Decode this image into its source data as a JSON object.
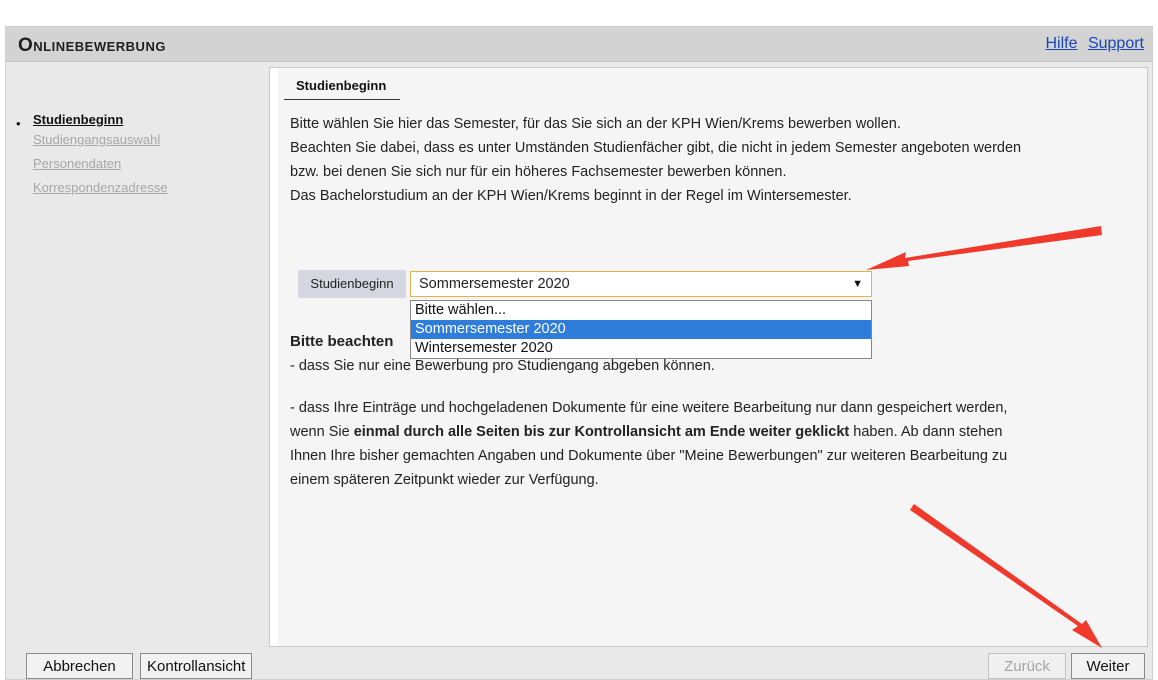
{
  "header": {
    "title": "Onlinebewerbung",
    "links": [
      "Hilfe",
      "Support"
    ]
  },
  "sidebar": {
    "items": [
      {
        "label": "Studienbeginn",
        "active": true
      },
      {
        "label": "Studiengangsauswahl",
        "active": false
      },
      {
        "label": "Personendaten",
        "active": false
      },
      {
        "label": "Korrespondenzadresse",
        "active": false
      }
    ]
  },
  "main": {
    "section_title": "Studienbeginn",
    "intro": [
      "Bitte wählen Sie hier das Semester, für das Sie sich an der KPH Wien/Krems bewerben wollen.",
      "Beachten Sie dabei, dass es unter Umständen Studienfächer gibt, die nicht in jedem Semester angeboten werden",
      "bzw. bei denen Sie sich nur für ein höheres Fachsemester bewerben können.",
      "Das Bachelorstudium an der KPH Wien/Krems beginnt in der Regel im Wintersemester."
    ],
    "field": {
      "label": "Studienbeginn",
      "selected": "Sommersemester 2020",
      "options": [
        "Bitte wählen...",
        "Sommersemester 2020",
        "Wintersemester 2020"
      ]
    },
    "notice": {
      "heading": "Bitte beachten",
      "point1": "- dass Sie nur eine Bewerbung pro Studiengang abgeben können.",
      "point2_a": "- dass Ihre Einträge und hochgeladenen Dokumente für eine weitere Bearbeitung nur dann gespeichert werden,",
      "point2_b_pre": "wenn Sie ",
      "point2_b_bold": "einmal durch alle Seiten bis zur Kontrollansicht am Ende weiter geklickt",
      "point2_b_post": " haben. Ab dann stehen",
      "point2_c": "Ihnen Ihre bisher gemachten Angaben und Dokumente über \"Meine Bewerbungen\" zur weiteren Bearbeitung zu",
      "point2_d": "einem späteren Zeitpunkt wieder zur Verfügung."
    }
  },
  "footer": {
    "cancel": "Abbrechen",
    "review": "Kontrollansicht",
    "back": "Zurück",
    "next": "Weiter"
  },
  "colors": {
    "header_bg": "#d3d3d3",
    "link": "#1a47b5",
    "selected_option": "#2e7ddb",
    "annotation_arrow": "#f0392b"
  }
}
